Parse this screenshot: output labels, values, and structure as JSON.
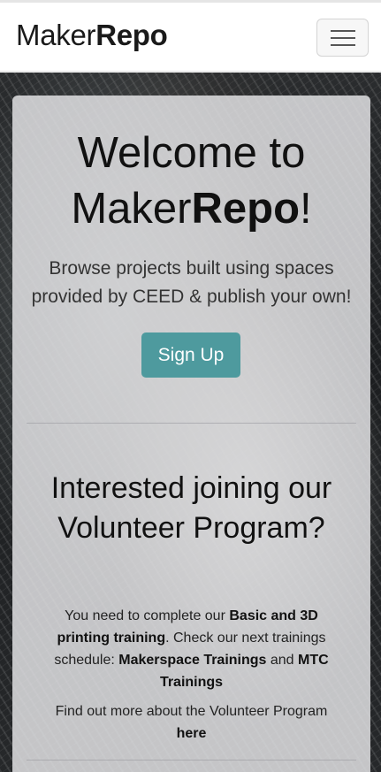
{
  "navbar": {
    "brand_light": "Maker",
    "brand_bold": "Repo",
    "toggler_label": "Toggle navigation"
  },
  "hero": {
    "welcome_line1": "Welcome to",
    "welcome_maker": "Maker",
    "welcome_repo": "Repo",
    "welcome_bang": "!",
    "subtitle": "Browse projects built using spaces provided by CEED & publish your own!",
    "signup_label": "Sign Up"
  },
  "volunteer": {
    "heading": "Interested joining our Volunteer Program?",
    "text_1": "You need to complete our ",
    "training_link": "Basic and 3D printing training",
    "text_2": ". Check our next trainings schedule: ",
    "makerspace_link": "Makerspace Trainings",
    "text_3": " and ",
    "mtc_link": "MTC Trainings",
    "find_out_text": "Find out more about the Volunteer Program ",
    "here_link": "here"
  },
  "colors": {
    "accent": "#4e9a9e",
    "card_bg": "#e4e4e6"
  }
}
